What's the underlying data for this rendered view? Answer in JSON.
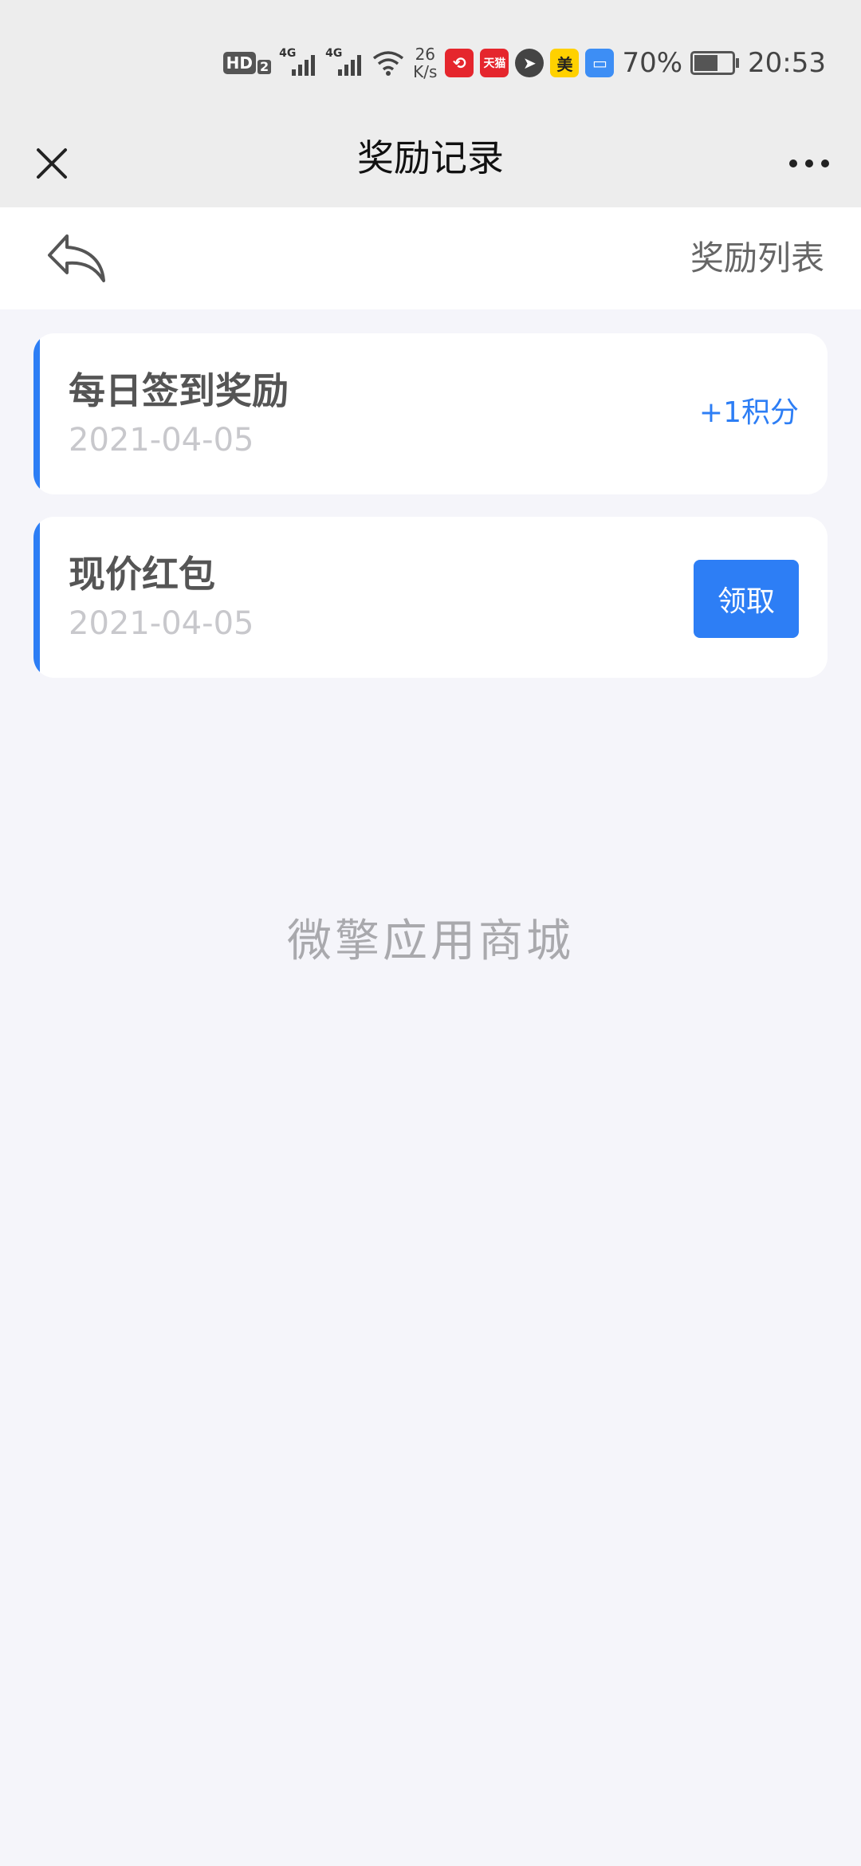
{
  "status_bar": {
    "hd_label": "HD",
    "hd_sub": "2",
    "signal1_label": "4G",
    "signal2_label": "4G",
    "net_speed_value": "26",
    "net_speed_unit": "K/s",
    "apps": [
      {
        "name": "ticket-app-icon",
        "color": "#e5262d",
        "glyph": "⟲"
      },
      {
        "name": "tmall-app-icon",
        "color": "#e5262d",
        "glyph": "天猫"
      },
      {
        "name": "paper-plane-app-icon",
        "color": "#444444",
        "glyph": "➤"
      },
      {
        "name": "meituan-app-icon",
        "color": "#ffd100",
        "glyph": "美"
      },
      {
        "name": "wallet-app-icon",
        "color": "#3d8ef5",
        "glyph": "▭"
      }
    ],
    "battery_percent": "70%",
    "battery_level": 0.7,
    "time": "20:53"
  },
  "titlebar": {
    "title": "奖励记录"
  },
  "subheader": {
    "list_link": "奖励列表"
  },
  "rewards": [
    {
      "title": "每日签到奖励",
      "date": "2021-04-05",
      "value": "+1积分"
    },
    {
      "title": "现价红包",
      "date": "2021-04-05",
      "button": "领取"
    }
  ],
  "footer": {
    "brand": "微擎应用商城"
  },
  "colors": {
    "accent": "#2d7ef5",
    "background": "#f5f5fa",
    "header": "#ededed"
  }
}
